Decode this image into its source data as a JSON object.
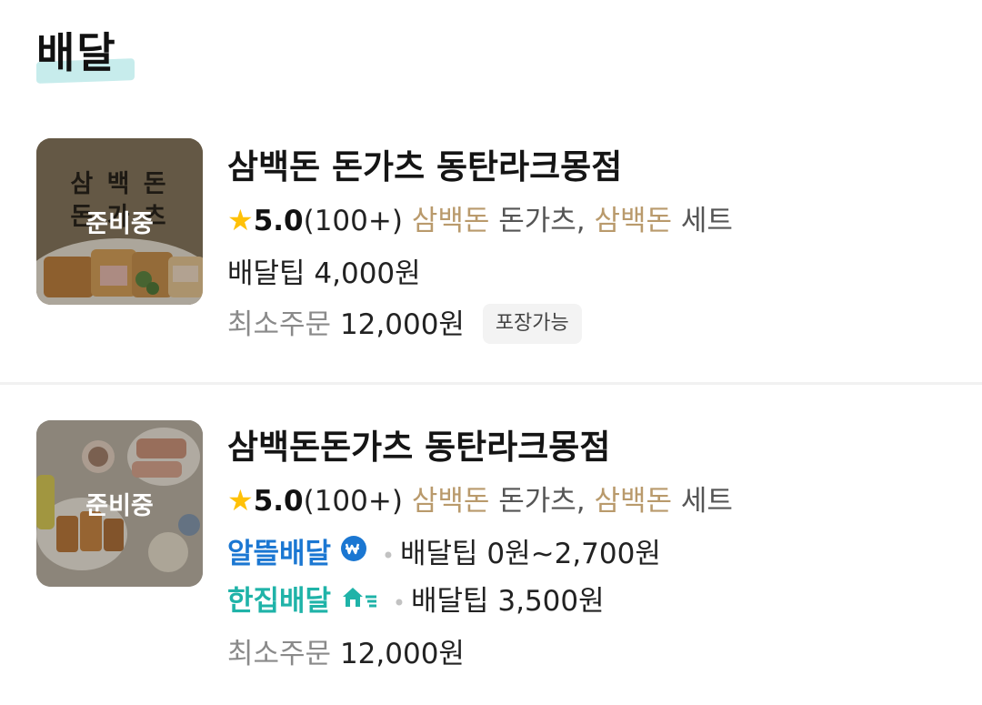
{
  "section": {
    "title": "배달"
  },
  "stores": [
    {
      "name": "삼백돈 돈가츠 동탄라크몽점",
      "thumb_text_line1": "삼 백 돈",
      "thumb_text_line2": "돈 가 츠",
      "status": "준비중",
      "star": "★",
      "rating": "5.0",
      "review_count": "(100+)",
      "menu_1a": "삼백돈",
      "menu_1b": " 돈가츠, ",
      "menu_2a": "삼백돈",
      "menu_2b": " 세트",
      "delivery_tip": "배달팁 4,000원",
      "min_order_label": "최소주문",
      "min_order_value": "12,000원",
      "badge": "포장가능"
    },
    {
      "name": "삼백돈돈가츠 동탄라크몽점",
      "status": "준비중",
      "star": "★",
      "rating": "5.0",
      "review_count": "(100+)",
      "menu_1a": "삼백돈",
      "menu_1b": " 돈가츠, ",
      "menu_2a": "삼백돈",
      "menu_2b": " 세트",
      "option_1_brand": "알뜰배달",
      "option_1_tip": "배달팁 0원~2,700원",
      "option_2_brand": "한집배달",
      "option_2_tip": "배달팁 3,500원",
      "dot": "•",
      "min_order_label": "최소주문",
      "min_order_value": "12,000원"
    }
  ],
  "colors": {
    "brand_blue": "#1b77d2",
    "brand_teal": "#1fb3a8",
    "menu_highlight": "#b99a6c",
    "star": "#ffc107"
  },
  "icons": [
    "won-icon",
    "home-fast-icon",
    "star-icon"
  ]
}
